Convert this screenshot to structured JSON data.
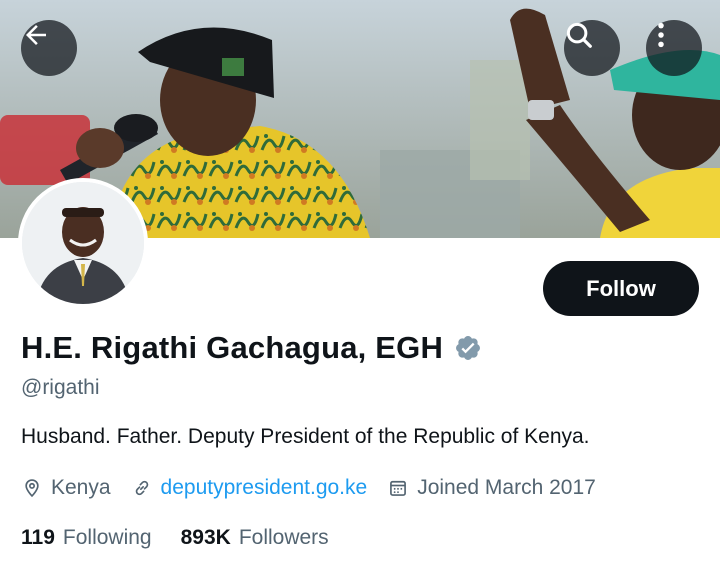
{
  "header": {
    "back_icon": "arrow-left-icon",
    "search_icon": "search-icon",
    "more_icon": "more-vertical-icon"
  },
  "profile": {
    "display_name": "H.E. Rigathi Gachagua, EGH",
    "verified_icon": "verified-badge-icon",
    "verified_color": "#829aab",
    "handle": "@rigathi",
    "bio": "Husband. Father. Deputy President of the Republic of Kenya.",
    "location": "Kenya",
    "website": "deputypresident.go.ke",
    "joined": "Joined March 2017"
  },
  "actions": {
    "follow_label": "Follow"
  },
  "stats": {
    "following_count": "119",
    "following_label": "Following",
    "followers_count": "893K",
    "followers_label": "Followers"
  },
  "colors": {
    "link": "#1d9bf0",
    "secondary_text": "#536471",
    "primary_text": "#0f1419",
    "button_bg": "#0f1419"
  }
}
